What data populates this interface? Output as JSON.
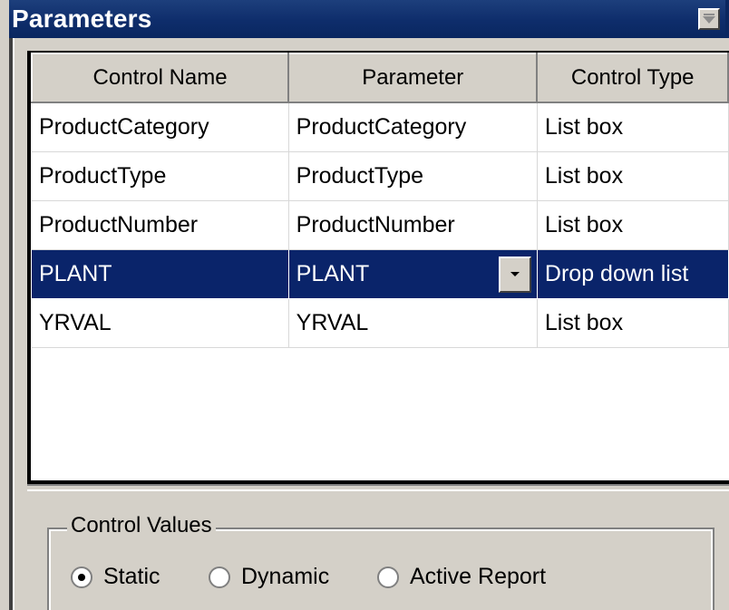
{
  "panel": {
    "title": "Parameters"
  },
  "grid": {
    "columns": [
      "Control Name",
      "Parameter",
      "Control Type"
    ],
    "rows": [
      {
        "control_name": "ProductCategory",
        "parameter": "ProductCategory",
        "control_type": "List box"
      },
      {
        "control_name": "ProductType",
        "parameter": "ProductType",
        "control_type": "List box"
      },
      {
        "control_name": "ProductNumber",
        "parameter": "ProductNumber",
        "control_type": "List box"
      },
      {
        "control_name": "PLANT",
        "parameter": "PLANT",
        "control_type": "Drop down list",
        "selected": true
      },
      {
        "control_name": "YRVAL",
        "parameter": "YRVAL",
        "control_type": "List box"
      }
    ]
  },
  "control_values": {
    "legend": "Control Values",
    "options": [
      "Static",
      "Dynamic",
      "Active Report"
    ],
    "selected": "Static"
  },
  "colors": {
    "title_bar": "#0e2d6b",
    "selection": "#0a246a",
    "face": "#d4d0c8"
  },
  "icons": {
    "title_button": "collapse-icon",
    "dropdown": "dropdown-arrow-icon"
  }
}
